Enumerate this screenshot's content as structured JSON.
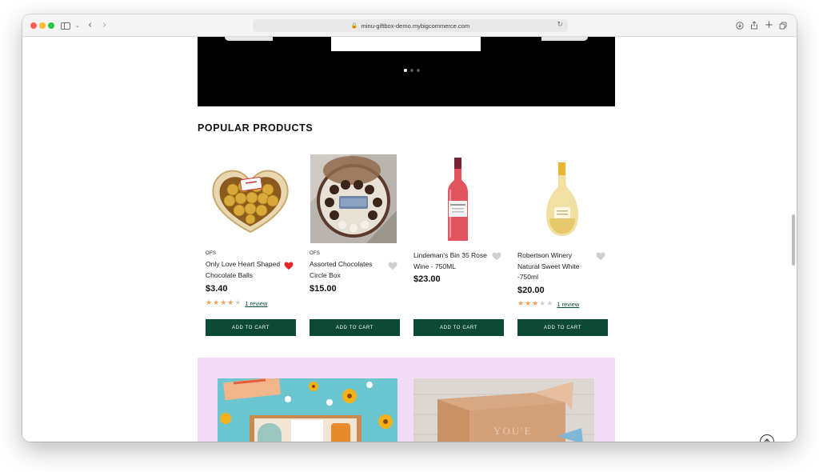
{
  "browser": {
    "url": "minu-giftbox-demo.mybigcommerce.com",
    "icons": [
      "sidebar-icon",
      "chevron-down-icon",
      "back-icon",
      "forward-icon",
      "lock-icon",
      "reload-icon",
      "download-icon",
      "share-icon",
      "new-tab-icon",
      "tabs-icon"
    ]
  },
  "hero": {
    "slides": 3,
    "active_slide": 1
  },
  "section": {
    "title": "POPULAR PRODUCTS"
  },
  "products": [
    {
      "brand": "OFS",
      "name_line1": "Only Love Heart Shaped",
      "name_line2": "Chocolate Balls",
      "name_line3": "",
      "price": "$3.40",
      "rating": 4,
      "review_text": "1 review",
      "wishlisted": true,
      "cta": "ADD TO CART"
    },
    {
      "brand": "OFS",
      "name_line1": "Assorted Chocolates",
      "name_line2": "Circle Box",
      "name_line3": "",
      "price": "$15.00",
      "rating": 0,
      "review_text": "",
      "wishlisted": false,
      "cta": "ADD TO CART"
    },
    {
      "brand": "",
      "name_line1": "Lindeman's Bin 35 Rose",
      "name_line2": "Wine - 750ML",
      "name_line3": "",
      "price": "$23.00",
      "rating": 0,
      "review_text": "",
      "wishlisted": false,
      "cta": "ADD TO CART"
    },
    {
      "brand": "",
      "name_line1": "Robertson Winery",
      "name_line2": "Natural Sweet White",
      "name_line3": "-750ml",
      "price": "$20.00",
      "rating": 3,
      "review_text": "1 review",
      "wishlisted": false,
      "cta": "ADD TO CART"
    }
  ],
  "colors": {
    "accent_button": "#0c4a36",
    "star": "#f1a154",
    "heart_active": "#e8262a",
    "promo_bg": "#f4dcf8"
  }
}
